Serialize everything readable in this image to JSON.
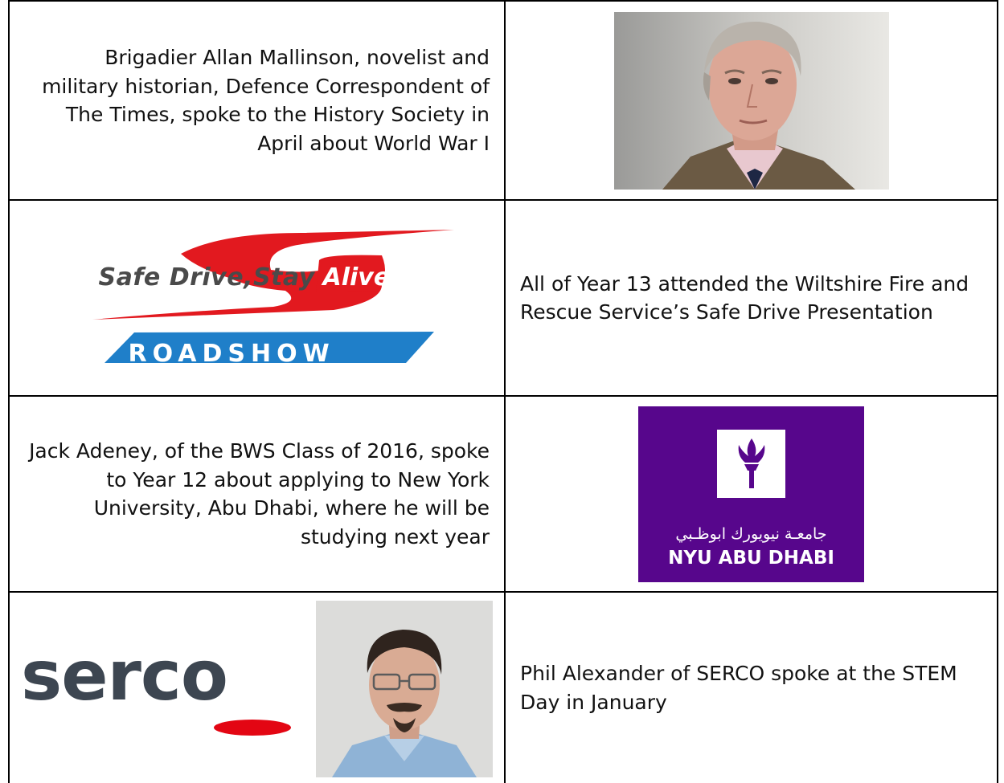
{
  "rows": [
    {
      "caption": "Brigadier Allan Mallinson, novelist and military historian, Defence Correspondent of The Times, spoke to the History Society in April about World War I",
      "image": "portrait-allan-mallinson"
    },
    {
      "caption": "All of Year 13 attended the Wiltshire Fire and Rescue Service’s Safe Drive Presentation",
      "logo": {
        "line1": "Safe Drive,Stay",
        "line1_highlight": "Alive",
        "banner": "ROADSHOW",
        "colors": {
          "swoosh": "#e2191f",
          "banner": "#1f7fc9",
          "text": "#4a4a4a"
        }
      }
    },
    {
      "caption": "Jack Adeney, of the BWS Class of 2016, spoke to Year 12 about applying to New York University, Abu Dhabi, where he will be studying next year",
      "logo": {
        "arabic": "جامعـة نيويورك ابوظـبي",
        "name": "NYU ABU DHABI",
        "colors": {
          "background": "#57068c",
          "torch": "#57068c"
        }
      }
    },
    {
      "caption": "Phil Alexander of SERCO spoke at the STEM Day in January",
      "logo": {
        "word": "serco",
        "colors": {
          "text": "#3d4651",
          "accent": "#e30613"
        }
      },
      "image": "portrait-phil-alexander"
    }
  ]
}
